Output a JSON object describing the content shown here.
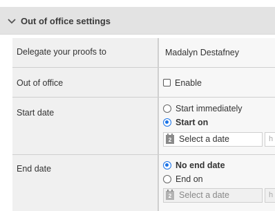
{
  "section": {
    "title": "Out of office settings"
  },
  "rows": {
    "delegate": {
      "label": "Delegate your proofs to",
      "value": "Madalyn Destafney"
    },
    "out_of_office": {
      "label": "Out of office",
      "checkbox_label": "Enable",
      "checked": false
    },
    "start_date": {
      "label": "Start date",
      "option_immediately": "Start immediately",
      "option_start_on": "Start on",
      "selected": "Start on",
      "date_placeholder": "Select a date",
      "time_stub": "h"
    },
    "end_date": {
      "label": "End date",
      "option_no_end": "No end date",
      "option_end_on": "End on",
      "selected": "No end date",
      "date_placeholder": "Select a date",
      "time_stub": "h"
    }
  },
  "calendar_icon_text": "2",
  "colors": {
    "accent": "#1a73e8",
    "header_bg": "#e3e3e3",
    "label_bg": "#f0f0f0"
  }
}
